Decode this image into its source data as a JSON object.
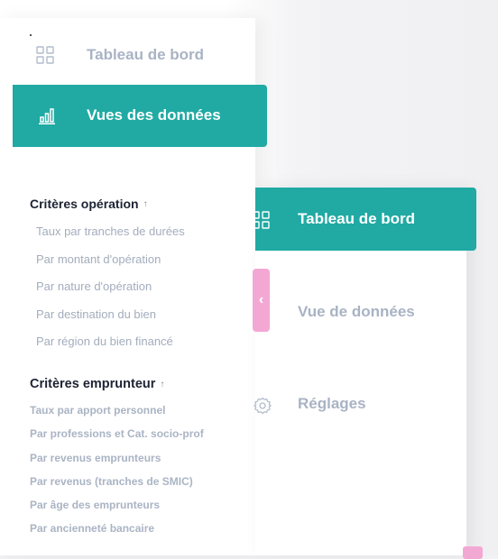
{
  "left_sidebar": {
    "dashboard_label": "Tableau de bord",
    "data_views_label": "Vues des données",
    "operation_section": {
      "title": "Critères opération",
      "arrow": "↑",
      "items": [
        "Taux par tranches de durées",
        "Par montant d'opération",
        "Par nature d'opération",
        "Par destination du bien",
        "Par région du bien financé"
      ]
    },
    "borrower_section": {
      "title": "Critères emprunteur",
      "arrow": "↑",
      "items": [
        "Taux par apport personnel",
        "Par professions et Cat. socio-prof",
        "Par revenus emprunteurs",
        "Par revenus (tranches de SMIC)",
        "Par âge des emprunteurs",
        "Par ancienneté bancaire"
      ]
    }
  },
  "collapse_handle": {
    "glyph": "‹"
  },
  "right_sidebar": {
    "dashboard_label": "Tableau de bord",
    "data_view_label": "Vue de données",
    "settings_label": "Réglages"
  },
  "colors": {
    "accent": "#20aaa3",
    "muted_text": "#a9b3c4",
    "heading_text": "#1d2333",
    "handle": "#f3a8d4"
  },
  "icons": {
    "dashboard": "grid-icon",
    "data_views": "bar-chart-icon",
    "settings": "gear-icon"
  }
}
